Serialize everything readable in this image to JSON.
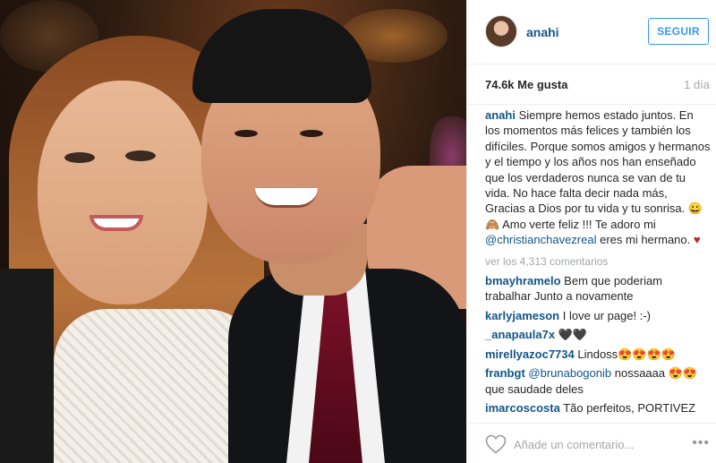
{
  "post": {
    "username": "anahi",
    "follow_label": "SEGUIR",
    "likes": "74.6k Me gusta",
    "time": "1 día",
    "caption": {
      "author": "anahi",
      "text_1": "Siempre hemos estado juntos. En los momentos más felices y también los difíciles. Porque somos amigos y hermanos y el tiempo y los años nos han enseñado que los verdaderos nunca se van de tu vida. No hace falta decir nada más, Gracias a Dios por tu vida y tu sonrisa. 😀🙈 Amo verte feliz !!! Te adoro mi ",
      "mention": "@christianchavezreal",
      "text_2": " eres mi hermano. ",
      "heart": "♥"
    },
    "view_all": "ver los 4,313 comentarios",
    "comments": [
      {
        "author": "bmayhramelo",
        "text": "Bem que poderiam trabalhar Junto a novamente",
        "mention": ""
      },
      {
        "author": "karlyjameson",
        "text": "I love ur page! :-)",
        "mention": ""
      },
      {
        "author": "_anapaula7x",
        "text": "🖤🖤",
        "mention": ""
      },
      {
        "author": "mirellyazoc7734",
        "text": "Lindoss😍😍😍😍",
        "mention": ""
      },
      {
        "author": "franbgt",
        "mention": "@brunabogonib",
        "text": " nossaaaa 😍😍 que saudade deles"
      },
      {
        "author": "imarcoscosta",
        "text": "Tão perfeitos, PORTIVEZ",
        "mention": ""
      }
    ],
    "comment_placeholder": "Añade un comentario...",
    "more_label": "•••",
    "icons": {
      "like": "heart-outline-icon",
      "more": "more-options-icon"
    },
    "colors": {
      "link": "#125688",
      "follow": "#3897f0",
      "muted": "#a5a7aa"
    }
  }
}
